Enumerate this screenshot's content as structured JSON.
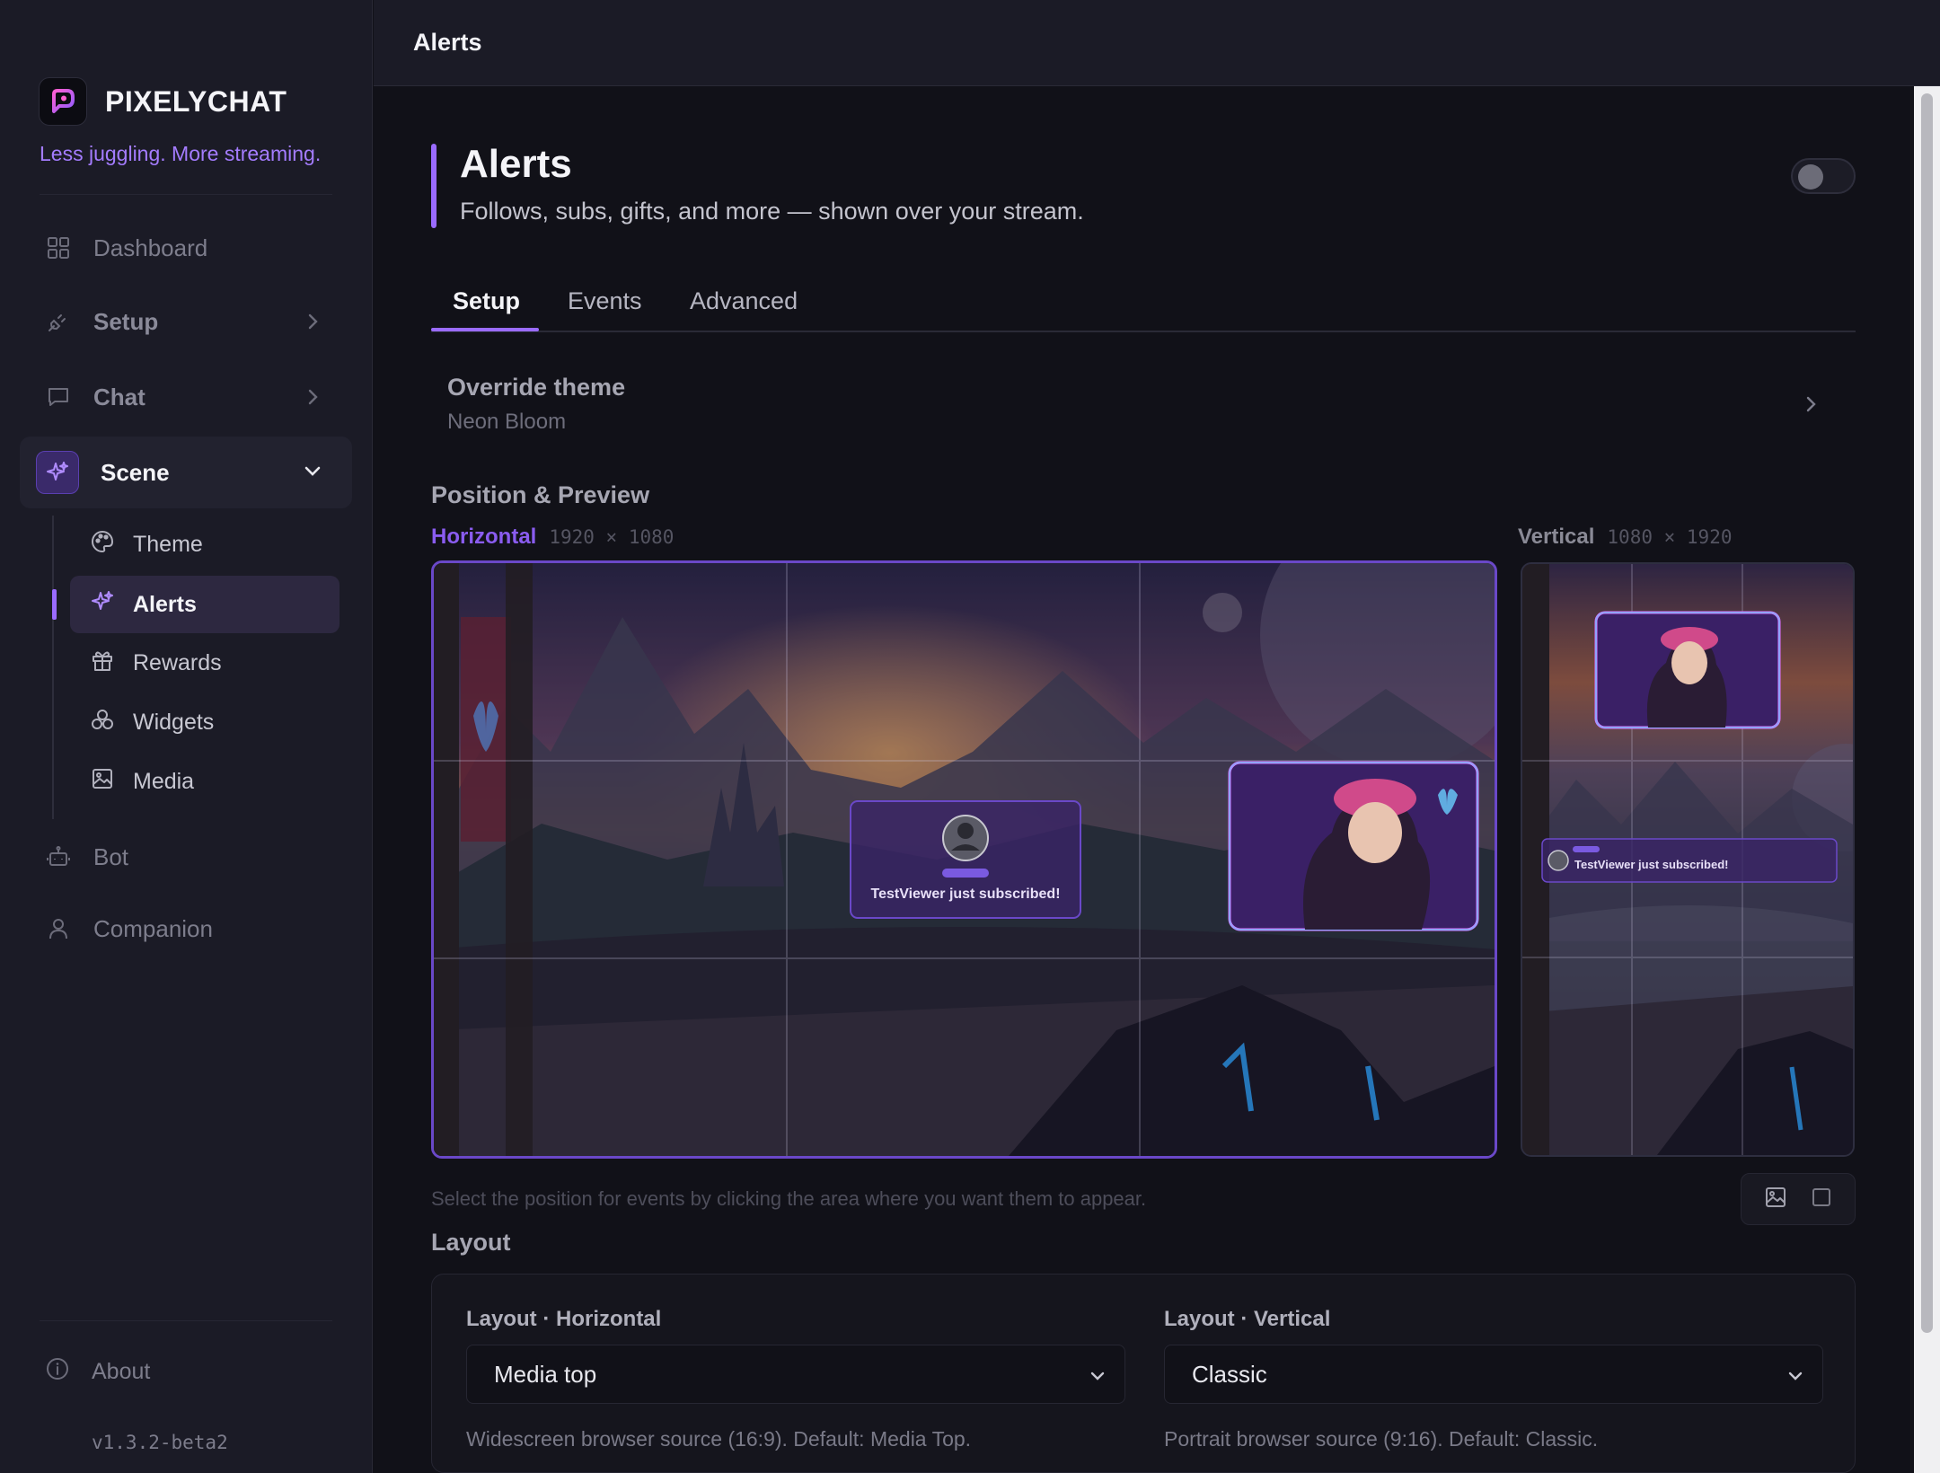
{
  "brand": {
    "name": "PIXELYCHAT",
    "tagline": "Less juggling. More streaming."
  },
  "sidebar": {
    "items": [
      {
        "label": "Dashboard"
      },
      {
        "label": "Setup"
      },
      {
        "label": "Chat"
      },
      {
        "label": "Scene"
      },
      {
        "label": "Bot"
      },
      {
        "label": "Companion"
      }
    ],
    "scene_children": [
      {
        "label": "Theme"
      },
      {
        "label": "Alerts"
      },
      {
        "label": "Rewards"
      },
      {
        "label": "Widgets"
      },
      {
        "label": "Media"
      }
    ],
    "about": "About",
    "version": "v1.3.2-beta2"
  },
  "topbar": {
    "title": "Alerts"
  },
  "header": {
    "title": "Alerts",
    "subtitle": "Follows, subs, gifts, and more — shown over your stream."
  },
  "tabs": [
    {
      "label": "Setup"
    },
    {
      "label": "Events"
    },
    {
      "label": "Advanced"
    }
  ],
  "override": {
    "title": "Override theme",
    "value": "Neon Bloom"
  },
  "position": {
    "title": "Position & Preview",
    "horizontal": {
      "label": "Horizontal",
      "dims": "1920 × 1080"
    },
    "vertical": {
      "label": "Vertical",
      "dims": "1080 × 1920"
    },
    "alert_text": "TestViewer just subscribed!",
    "hint": "Select the position for events by clicking the area where you want them to appear."
  },
  "layout": {
    "title": "Layout",
    "horizontal": {
      "label": "Layout · Horizontal",
      "value": "Media top",
      "help": "Widescreen browser source (16:9). Default: Media Top."
    },
    "vertical": {
      "label": "Layout · Vertical",
      "value": "Classic",
      "help": "Portrait browser source (9:16). Default: Classic."
    }
  },
  "colors": {
    "accent": "#9a6bff",
    "sidebar_bg": "#1b1b26",
    "main_bg": "#111118"
  }
}
